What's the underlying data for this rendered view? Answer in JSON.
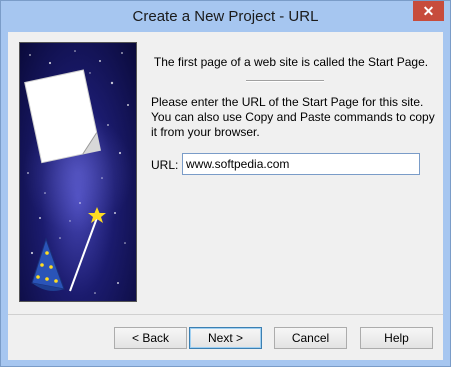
{
  "window": {
    "title": "Create a New Project - URL",
    "close_glyph": "✕"
  },
  "content": {
    "intro": "The first page of a web site is called the Start Page.",
    "description": "Please enter the URL of the Start Page for this site. You can also use Copy and Paste commands to copy it from your browser.",
    "url_label": "URL:",
    "url_value": "www.softpedia.com"
  },
  "buttons": {
    "back": "< Back",
    "next": "Next >",
    "cancel": "Cancel",
    "help": "Help"
  },
  "colors": {
    "titlebar": "#a6c6f0",
    "close_button": "#c74c3c",
    "image_background": "#1b1b6e"
  },
  "icons": [
    "close-icon",
    "wizard-hat-illustration"
  ]
}
